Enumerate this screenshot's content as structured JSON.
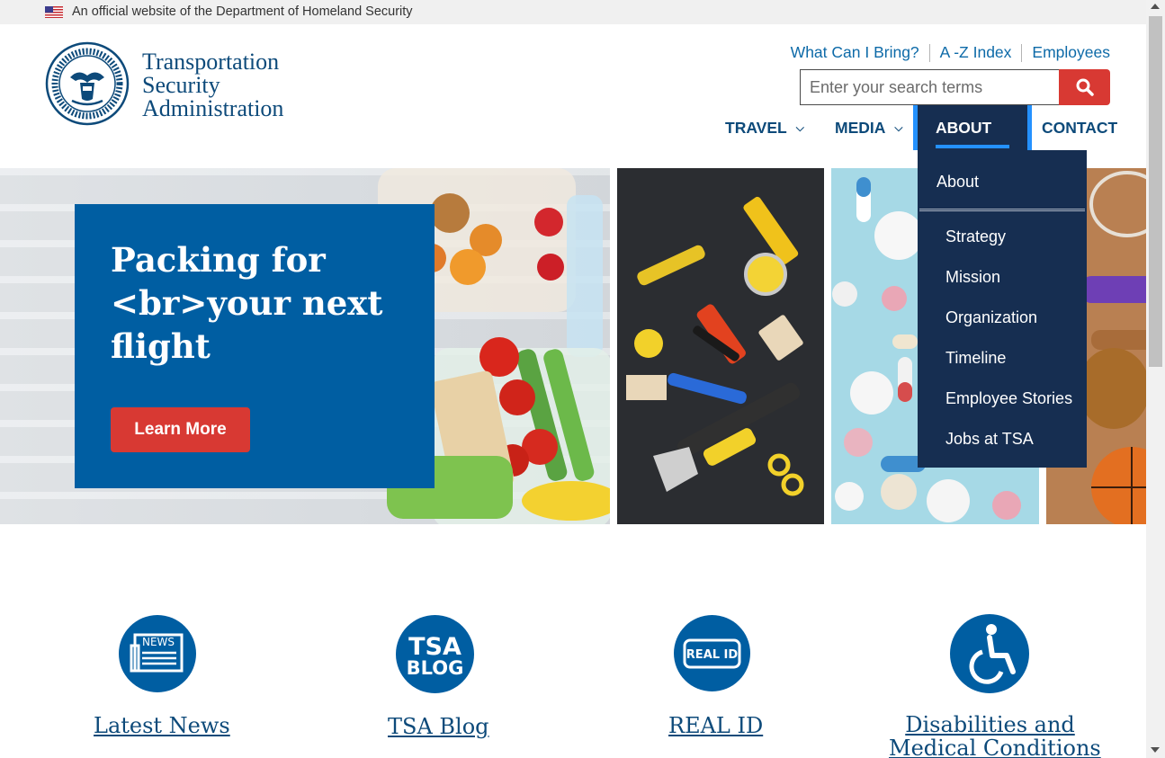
{
  "gov_banner": {
    "text": "An official website of the Department of Homeland Security",
    "flag_icon": "us-flag-icon"
  },
  "brand": {
    "line1": "Transportation",
    "line2": "Security",
    "line3": "Administration",
    "seal_icon": "dhs-seal-icon"
  },
  "utility_nav": [
    {
      "label": "What Can I Bring?"
    },
    {
      "label": "A -Z Index"
    },
    {
      "label": "Employees"
    }
  ],
  "search": {
    "placeholder": "Enter your search terms",
    "value": "",
    "button_icon": "search-icon"
  },
  "main_nav": {
    "travel": "TRAVEL",
    "media": "MEDIA",
    "about": "ABOUT",
    "contact": "CONTACT"
  },
  "about_menu": {
    "heading": "About",
    "items": [
      "Strategy",
      "Mission",
      "Organization",
      "Timeline",
      "Employee Stories",
      "Jobs at TSA"
    ]
  },
  "hero": {
    "title_line1": "Packing for",
    "title_line2": "<br>your next",
    "title_line3": "flight",
    "button": "Learn More"
  },
  "quick_links": [
    {
      "label": "Latest News",
      "icon": "newspaper-icon",
      "icon_text": "NEWS"
    },
    {
      "label": "TSA Blog",
      "icon": "tsa-blog-icon",
      "icon_text_1": "TSA",
      "icon_text_2": "BLOG"
    },
    {
      "label": "REAL ID",
      "icon": "real-id-icon",
      "icon_text": "REAL ID"
    },
    {
      "label": "Disabilities and",
      "label2": "Medical Conditions",
      "icon": "wheelchair-icon"
    }
  ],
  "colors": {
    "primary": "#005ea2",
    "navy": "#162e51",
    "accent_red": "#d83933",
    "accent_blue": "#2491ff",
    "text_blue": "#0d4a7a"
  }
}
